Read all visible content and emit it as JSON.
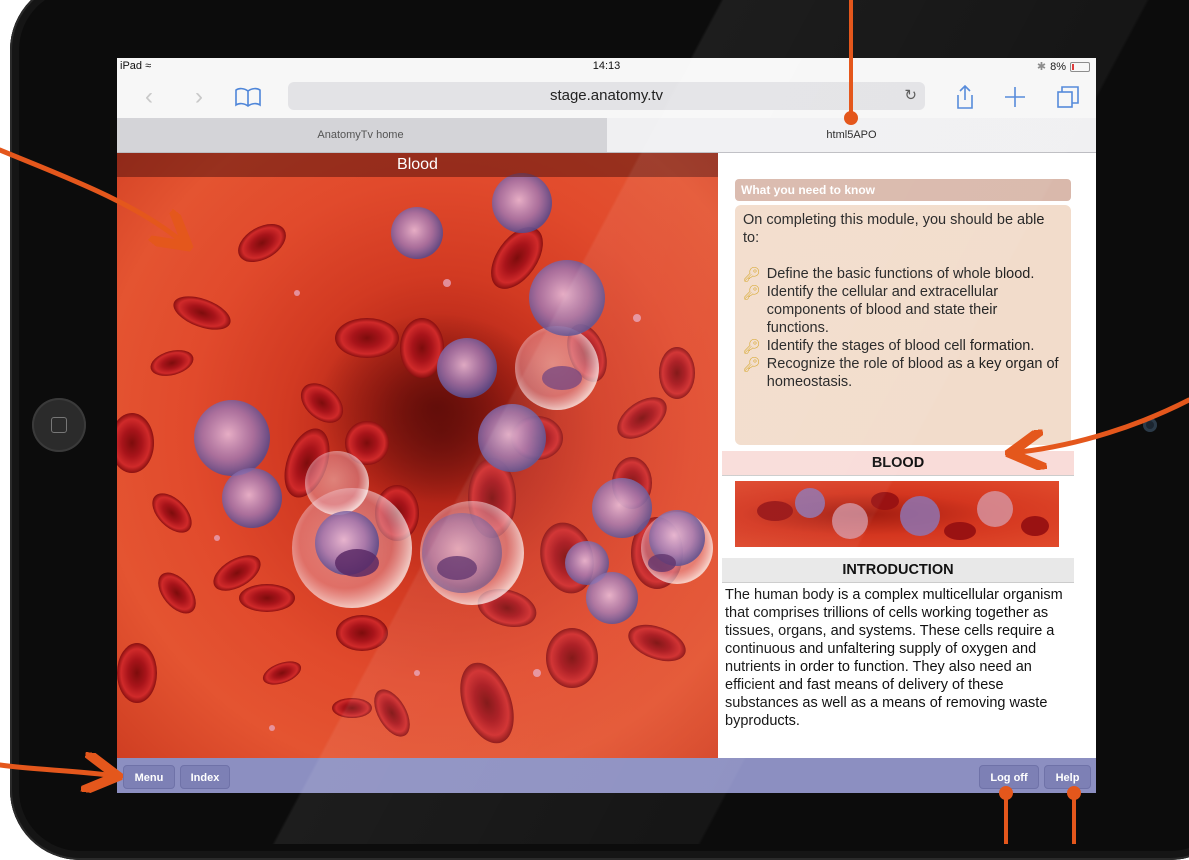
{
  "status_bar": {
    "device": "iPad",
    "time": "14:13",
    "battery": "8%"
  },
  "browser": {
    "url": "stage.anatomy.tv",
    "tabs": [
      {
        "label": "AnatomyTv home",
        "active": false
      },
      {
        "label": "html5APO",
        "active": true
      }
    ]
  },
  "left_pane": {
    "title": "Blood"
  },
  "right_pane": {
    "wynk_heading": "What you need to know",
    "wynk_intro": "On completing this module, you should be able to:",
    "objectives": [
      "Define the basic functions of whole blood.",
      "Identify the cellular and extracellular components of blood and state their functions.",
      "Identify the stages of blood cell formation.",
      "Recognize the role of blood as a key organ of homeostasis."
    ],
    "section_blood": "BLOOD",
    "section_intro": "INTRODUCTION",
    "intro_text": "The human body is a complex multicellular organism that comprises trillions of cells working together as tissues, organs, and systems. These cells require a continuous and unfaltering supply of oxygen and nutrients in order to function. They also need an efficient and fast means of delivery of these substances as well as a means of removing waste byproducts."
  },
  "bottom_bar": {
    "menu": "Menu",
    "index": "Index",
    "log_off": "Log off",
    "help": "Help"
  },
  "colors": {
    "accent_bar": "#8c8fc1",
    "annotation_orange": "#e4571c",
    "wynk_box": "#f2dccb",
    "blood_red": "#d23a22"
  }
}
